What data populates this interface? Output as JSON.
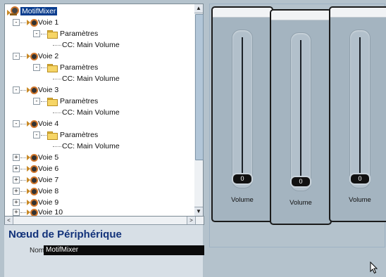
{
  "tree": {
    "root": {
      "label": "MotifMixer",
      "expander": "-"
    },
    "parameters_label": "Paramètres",
    "cc_label": "CC: Main Volume",
    "voices_expanded": [
      {
        "label": "Voie 1",
        "expander": "-",
        "folder_expander": "-"
      },
      {
        "label": "Voie 2",
        "expander": "-",
        "folder_expander": "-"
      },
      {
        "label": "Voie 3",
        "expander": "-",
        "folder_expander": "-"
      },
      {
        "label": "Voie 4",
        "expander": "-",
        "folder_expander": "-"
      }
    ],
    "voices_collapsed": [
      {
        "label": "Voie 5",
        "expander": "+"
      },
      {
        "label": "Voie 6",
        "expander": "+"
      },
      {
        "label": "Voie 7",
        "expander": "+"
      },
      {
        "label": "Voie 8",
        "expander": "+"
      },
      {
        "label": "Voie 9",
        "expander": "+"
      },
      {
        "label": "Voie 10",
        "expander": "+"
      }
    ]
  },
  "scroll": {
    "up_arrow": "▲",
    "down_arrow": "▼",
    "left_arrow": "<",
    "right_arrow": ">",
    "vertical_position": 0
  },
  "node_panel": {
    "title": "Nœud de Périphérique",
    "name_label": "Nom",
    "name_value": "MotifMixer"
  },
  "mixer": {
    "channels": [
      {
        "label": "Volume",
        "value": "0"
      },
      {
        "label": "Volume",
        "value": "0"
      },
      {
        "label": "Volume",
        "value": "0"
      }
    ]
  },
  "colors": {
    "selection": "#0a3d8e",
    "panel_bg": "#b4c2cc",
    "title_text": "#12327a"
  }
}
